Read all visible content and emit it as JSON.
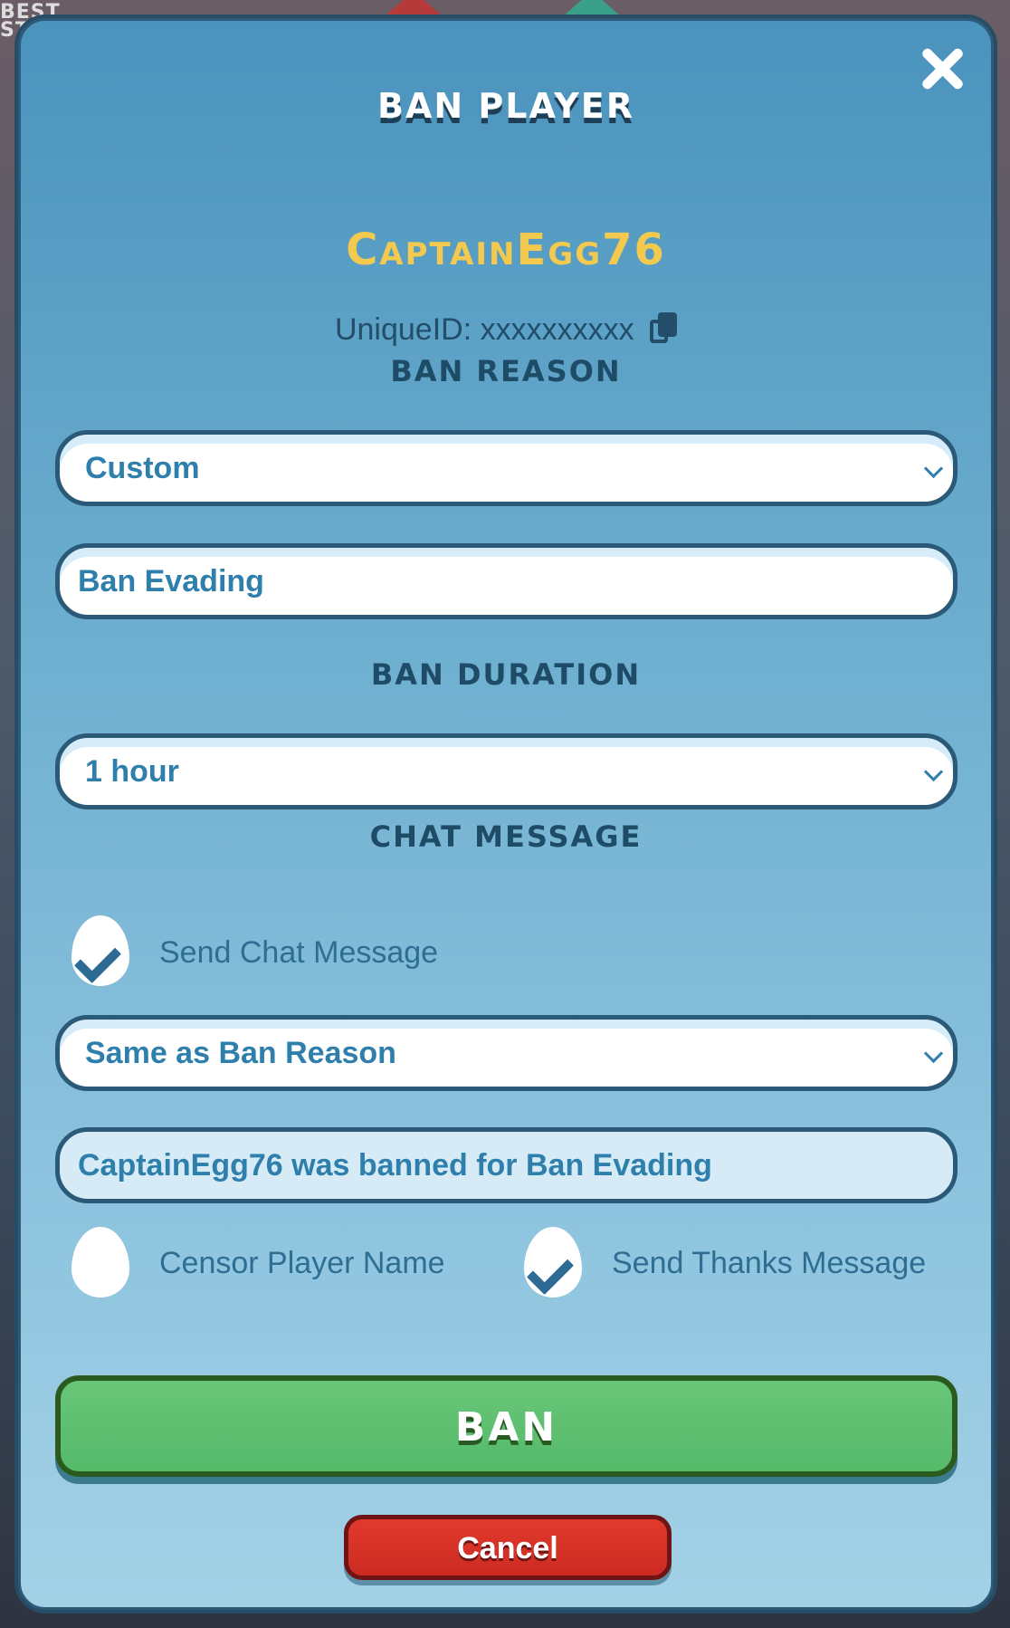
{
  "background": {
    "corner_text": "BEST\nST"
  },
  "modal": {
    "title": "BAN PLAYER",
    "close_icon": "close-icon",
    "player_name": "CaptainEgg76",
    "unique_id": "UniqueID: xxxxxxxxxx",
    "copy_icon": "copy-icon"
  },
  "ban_reason": {
    "label": "BAN REASON",
    "selected": "Custom",
    "custom_text": "Ban Evading"
  },
  "ban_duration": {
    "label": "BAN DURATION",
    "selected": "1 hour"
  },
  "chat_message": {
    "label": "CHAT MESSAGE",
    "send_chat_label": "Send Chat Message",
    "send_chat_checked": true,
    "message_source": "Same as Ban Reason",
    "message_text": "CaptainEgg76 was banned for Ban Evading",
    "censor_label": "Censor Player Name",
    "censor_checked": false,
    "thanks_label": "Send Thanks Message",
    "thanks_checked": true
  },
  "actions": {
    "ban_label": "BAN",
    "cancel_label": "Cancel"
  },
  "colors": {
    "accent_name": "#f3c94f",
    "ban_green": "#55b96a",
    "cancel_red": "#cc2b22",
    "dark_blue": "#1e4b66"
  }
}
